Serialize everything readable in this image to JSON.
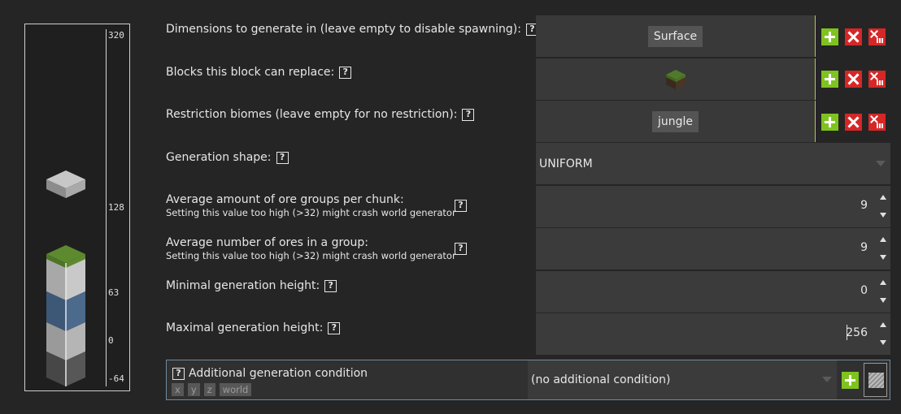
{
  "preview": {
    "ticks": [
      "320",
      "128",
      "63",
      "0",
      "-64"
    ]
  },
  "fields": {
    "dimensions": {
      "label": "Dimensions to generate in (leave empty to disable spawning):",
      "chip": "Surface"
    },
    "replace": {
      "label": "Blocks this block can replace:",
      "chip_icon": "grass-block-icon"
    },
    "biomes": {
      "label": "Restriction biomes (leave empty for no restriction):",
      "chip": "jungle"
    },
    "shape": {
      "label": "Generation shape:",
      "value": "UNIFORM"
    },
    "groups": {
      "label": "Average amount of ore groups per chunk:",
      "sub": "Setting this value too high (>32) might crash world generator",
      "value": "9"
    },
    "ores": {
      "label": "Average number of ores in a group:",
      "sub": "Setting this value too high (>32) might crash world generator",
      "value": "9"
    },
    "min_height": {
      "label": "Minimal generation height:",
      "value": "0"
    },
    "max_height": {
      "label": "Maximal generation height:",
      "value": "256"
    }
  },
  "help_glyph": "?",
  "condition": {
    "title": "Additional generation condition",
    "params": [
      "x",
      "y",
      "z",
      "world"
    ],
    "selected": "(no additional condition)"
  },
  "colors": {
    "accent_green": "#7fc31f",
    "delete_red": "#d62727",
    "list_border": "#b8c930",
    "panel_border": "#6d8aa0"
  }
}
